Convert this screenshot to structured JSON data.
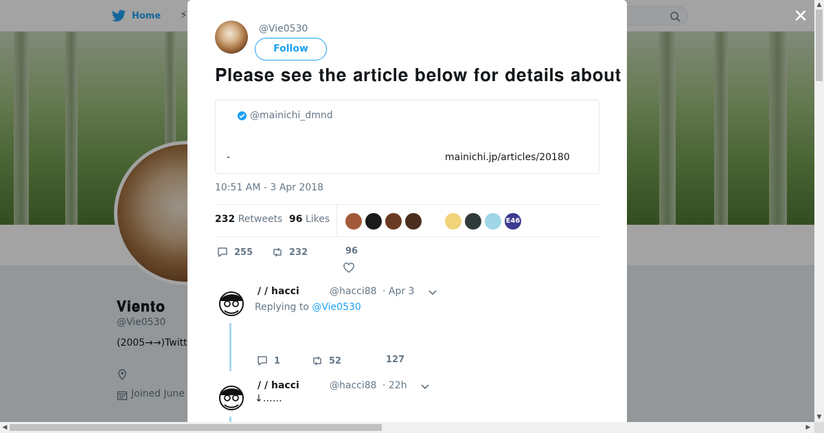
{
  "topbar": {
    "home_label": "Home",
    "home_icon": "twitter-bird-icon",
    "search_icon": "search-icon"
  },
  "profile": {
    "name": "𝐕𝐢𝐞𝐧𝐭𝐨",
    "handle": "@Vie0530",
    "bio": "(2005→→)Twitt",
    "joined": "Joined June"
  },
  "modal": {
    "close_label": "✕",
    "author_handle": "@Vie0530",
    "follow_label": "Follow",
    "tweet_text": "𝐏𝐥𝐞𝐚𝐬𝐞 𝐬𝐞𝐞 𝐭𝐡𝐞 𝐚𝐫𝐭𝐢𝐜𝐥𝐞 𝐛𝐞𝐥𝐨𝐰 𝐟𝐨𝐫 𝐝𝐞𝐭𝐚𝐢𝐥𝐬 𝐚𝐛𝐨𝐮𝐭 𝐭𝐡𝐢𝐬 𝐧𝐞𝐰𝐬 𝐬𝐭𝐨𝐫𝐲",
    "quote": {
      "handle": "@mainichi_dmnd",
      "dash": "-",
      "link": "mainichi.jp/articles/20180"
    },
    "timestamp": "10:51 AM - 3 Apr 2018",
    "stats": {
      "retweets_count": "232",
      "retweets_label": "Retweets",
      "likes_count": "96",
      "likes_label": "Likes"
    },
    "likers": [
      {
        "color": "#a35a3a"
      },
      {
        "color": "#1a1a1a"
      },
      {
        "color": "#6b3a22"
      },
      {
        "color": "#4a2e1e"
      },
      {
        "color": "#f1d37a"
      },
      {
        "color": "#2f3a3a"
      },
      {
        "color": "#9fd6e8"
      },
      {
        "color": "#3b3b8f",
        "label": "E46"
      }
    ],
    "actions": {
      "replies": "255",
      "retweets": "232",
      "likes": "96"
    },
    "replies": [
      {
        "name": "/ / hacci",
        "handle": "@hacci88",
        "time": "· Apr 3",
        "replying_prefix": "Replying to",
        "replying_to": "@Vie0530",
        "reply_count": "1",
        "retweet_count": "52",
        "like_count": "127"
      },
      {
        "name": "/ / hacci",
        "handle": "@hacci88",
        "time": "· 22h",
        "text": "↓……"
      }
    ]
  },
  "colors": {
    "accent": "#1da1f2",
    "muted": "#657786",
    "thread_line": "#a6d7f5"
  }
}
